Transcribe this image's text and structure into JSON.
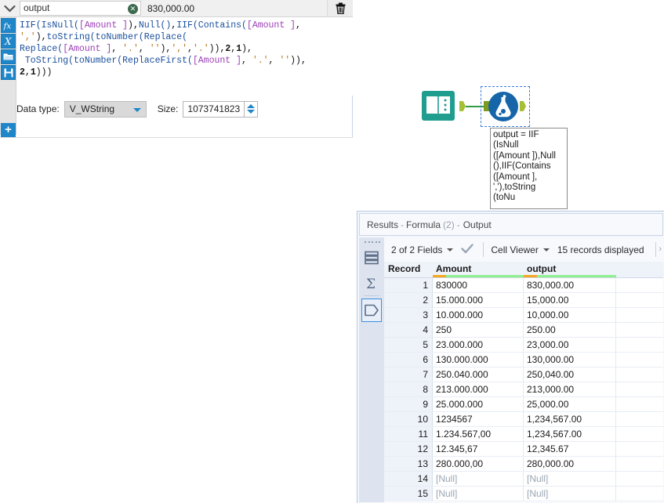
{
  "config_panel": {
    "collapse_icon": "chevron-down-icon",
    "field_name": "output",
    "clear_icon": "clear-circle-icon",
    "preview_value": "830,000.00",
    "delete_icon": "trash-icon",
    "rail_icons": [
      "fx-icon",
      "variable-x-icon",
      "open-folder-icon",
      "save-floppy-icon"
    ],
    "add_button_label": "+",
    "expression_tokens": [
      {
        "t": "IIF(",
        "c": "fn"
      },
      {
        "t": "IsNull(",
        "c": "fn"
      },
      {
        "t": "[Amount ]",
        "c": "field"
      },
      {
        "t": "),",
        "c": "plain"
      },
      {
        "t": "Null()",
        "c": "fn"
      },
      {
        "t": ",",
        "c": "plain"
      },
      {
        "t": "IIF(",
        "c": "fn"
      },
      {
        "t": "Contains(",
        "c": "fn"
      },
      {
        "t": "[Amount ]",
        "c": "field"
      },
      {
        "t": ",\n",
        "c": "plain"
      },
      {
        "t": "','",
        "c": "str"
      },
      {
        "t": "),",
        "c": "plain"
      },
      {
        "t": "toString(",
        "c": "fn"
      },
      {
        "t": "toNumber(",
        "c": "fn"
      },
      {
        "t": "Replace(",
        "c": "fn"
      },
      {
        "t": "\n",
        "c": "plain"
      },
      {
        "t": "Replace(",
        "c": "fn"
      },
      {
        "t": "[Amount ]",
        "c": "field"
      },
      {
        "t": ", ",
        "c": "plain"
      },
      {
        "t": "'.'",
        "c": "str"
      },
      {
        "t": ", ",
        "c": "plain"
      },
      {
        "t": "''",
        "c": "str"
      },
      {
        "t": "),",
        "c": "plain"
      },
      {
        "t": "','",
        "c": "str"
      },
      {
        "t": ",",
        "c": "plain"
      },
      {
        "t": "'.'",
        "c": "str"
      },
      {
        "t": ")),",
        "c": "plain"
      },
      {
        "t": "2",
        "c": "num"
      },
      {
        "t": ",",
        "c": "plain"
      },
      {
        "t": "1",
        "c": "num"
      },
      {
        "t": "),\n ",
        "c": "plain"
      },
      {
        "t": "ToString(",
        "c": "fn"
      },
      {
        "t": "toNumber(",
        "c": "fn"
      },
      {
        "t": "ReplaceFirst(",
        "c": "fn"
      },
      {
        "t": "[Amount ]",
        "c": "field"
      },
      {
        "t": ", ",
        "c": "plain"
      },
      {
        "t": "'.'",
        "c": "str"
      },
      {
        "t": ", ",
        "c": "plain"
      },
      {
        "t": "''",
        "c": "str"
      },
      {
        "t": ")),\n",
        "c": "plain"
      },
      {
        "t": "2",
        "c": "num"
      },
      {
        "t": ",",
        "c": "plain"
      },
      {
        "t": "1",
        "c": "num"
      },
      {
        "t": ")))",
        "c": "plain"
      }
    ],
    "datatype_label": "Data type:",
    "datatype_value": "V_WString",
    "size_label": "Size:",
    "size_value": "1073741823"
  },
  "canvas": {
    "input_tool_icon": "input-data-book-icon",
    "formula_tool_icon": "formula-flask-icon",
    "annotation_text": "output = IIF\n(IsNull\n([Amount ]),Null\n(),IIF(Contains\n([Amount ],\n','),toString\n(toNu"
  },
  "results": {
    "title_prefix": "Results",
    "title_sep1": "-",
    "title_tool": "Formula",
    "title_tool_num": "(2)",
    "title_sep2": "-",
    "title_anchor": "Output",
    "toolbar": {
      "fields_label": "2 of 2 Fields",
      "check_icon": "checkmark-icon",
      "viewer_label": "Cell Viewer",
      "records_label": "15 records displayed",
      "overflow_icon": "chevron-icon"
    },
    "rail_icons": [
      "data-rows-icon",
      "summary-sigma-icon",
      "metadata-tag-icon"
    ],
    "columns": [
      "Record",
      "Amount",
      "output"
    ],
    "rows": [
      {
        "record": "1",
        "amount": "830000",
        "output": "830,000.00",
        "null": false
      },
      {
        "record": "2",
        "amount": "15.000.000",
        "output": "15,000.00",
        "null": false
      },
      {
        "record": "3",
        "amount": "10.000.000",
        "output": "10,000.00",
        "null": false
      },
      {
        "record": "4",
        "amount": "250",
        "output": "250.00",
        "null": false
      },
      {
        "record": "5",
        "amount": "23.000.000",
        "output": "23,000.00",
        "null": false
      },
      {
        "record": "6",
        "amount": "130.000.000",
        "output": "130,000.00",
        "null": false
      },
      {
        "record": "7",
        "amount": "250.040.000",
        "output": "250,040.00",
        "null": false
      },
      {
        "record": "8",
        "amount": "213.000.000",
        "output": "213,000.00",
        "null": false
      },
      {
        "record": "9",
        "amount": "25.000.000",
        "output": "25,000.00",
        "null": false
      },
      {
        "record": "10",
        "amount": "1234567",
        "output": "1,234,567.00",
        "null": false
      },
      {
        "record": "11",
        "amount": "1.234.567,00",
        "output": "1,234,567.00",
        "null": false
      },
      {
        "record": "12",
        "amount": "12.345,67",
        "output": "12,345.67",
        "null": false
      },
      {
        "record": "13",
        "amount": "280.000,00",
        "output": "280,000.00",
        "null": false
      },
      {
        "record": "14",
        "amount": "[Null]",
        "output": "[Null]",
        "null": true
      },
      {
        "record": "15",
        "amount": "[Null]",
        "output": "[Null]",
        "null": true
      }
    ]
  },
  "colors": {
    "accent_blue": "#1f86c9",
    "selection_blue": "#3b7dd8",
    "header_green": "#8ef08e",
    "header_orange": "#f5a623",
    "connector_green": "#2f9e44",
    "input_tool_teal": "#1f9d8f",
    "formula_tool_blue": "#1565a8"
  }
}
